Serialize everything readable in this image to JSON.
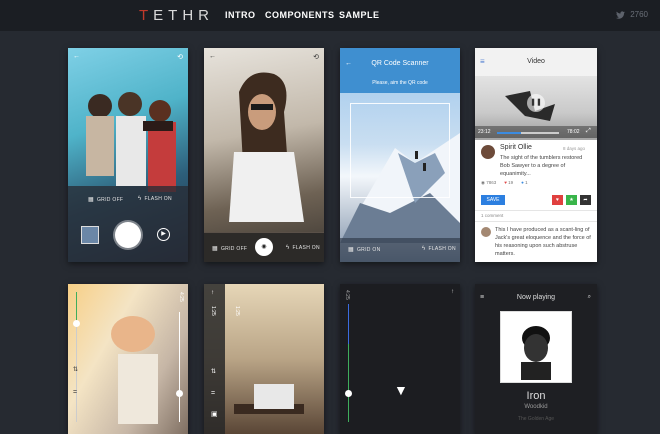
{
  "nav": {
    "logo": "TETHR",
    "links": [
      "INTRO",
      "COMPONENTS",
      "SAMPLE"
    ],
    "twitter_count": "2760"
  },
  "camera1": {
    "grid_label": "GRID OFF",
    "flash_label": "FLASH ON"
  },
  "camera2": {
    "grid_label": "GRID OFF",
    "flash_label": "FLASH ON"
  },
  "qr": {
    "title": "QR Code Scanner",
    "hint": "Please, aim the QR code",
    "grid_label": "GRID ON",
    "flash_label": "FLASH ON"
  },
  "video": {
    "title": "Video",
    "time_current": "23:12",
    "time_total": "78:02",
    "progress": 0.38,
    "author": "Spirit Ollie",
    "age": "8 days ago",
    "text": "The sight of the tumblers restored Bob Sawyer to a degree of equanimity...",
    "views": "7863",
    "likes": "19",
    "comments_count": "1",
    "save_label": "SAVE",
    "comment_header": "1 comment",
    "comment_text": "This I have produced as a scant-ling of Jack's great eloquence and the force of his reasoning upon such abstruse matters."
  },
  "row2": {
    "left_top_label": "4:25",
    "mid_top_label": "1:25",
    "mid_right_label": "1:25",
    "dark_label": "4:25"
  },
  "player": {
    "header": "Now playing",
    "track": "Iron",
    "artist": "Woodkid",
    "album": "The Golden Age"
  }
}
